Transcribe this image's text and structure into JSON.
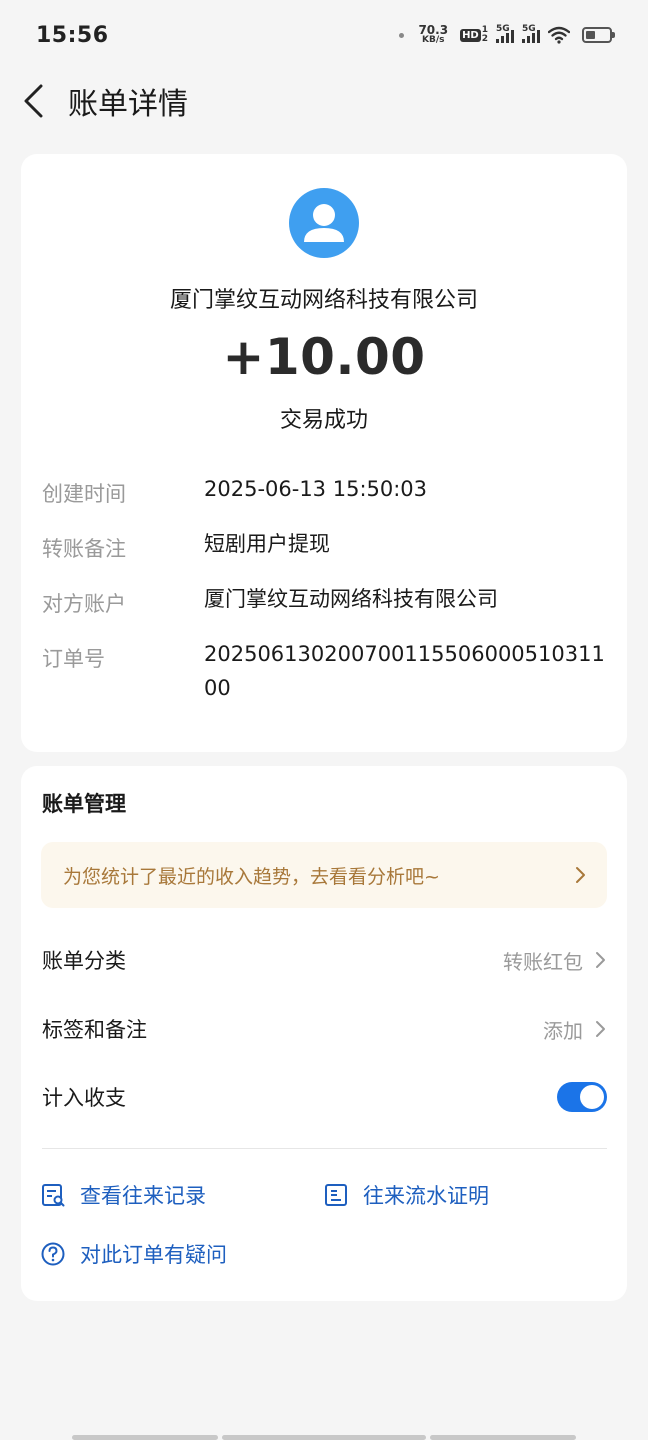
{
  "status_bar": {
    "time": "15:56",
    "speed_value": "70.3",
    "speed_unit": "KB/s",
    "hd_label": "HD",
    "hd_sub1": "1",
    "hd_sub2": "2",
    "sig1_label": "5G",
    "sig2_label": "5G"
  },
  "nav": {
    "title": "账单详情"
  },
  "summary": {
    "merchant": "厦门掌纹互动网络科技有限公司",
    "amount": "+10.00",
    "status": "交易成功"
  },
  "details": [
    {
      "label": "创建时间",
      "value": "2025-06-13 15:50:03"
    },
    {
      "label": "转账备注",
      "value": "短剧用户提现"
    },
    {
      "label": "对方账户",
      "value": "厦门掌纹互动网络科技有限公司"
    },
    {
      "label": "订单号",
      "value": "20250613020070011550600051031100"
    }
  ],
  "management": {
    "title": "账单管理",
    "banner_text": "为您统计了最近的收入趋势，去看看分析吧~",
    "category_label": "账单分类",
    "category_value": "转账红包",
    "tags_label": "标签和备注",
    "tags_value": "添加",
    "include_label": "计入收支",
    "include_enabled": true,
    "link_records": "查看往来记录",
    "link_proof": "往来流水证明",
    "link_question": "对此订单有疑问"
  },
  "colors": {
    "accent": "#1b74e8",
    "link": "#1e5fbf",
    "avatar": "#3f9ff0",
    "banner_bg": "#fcf7ed",
    "banner_text": "#a8783a"
  }
}
